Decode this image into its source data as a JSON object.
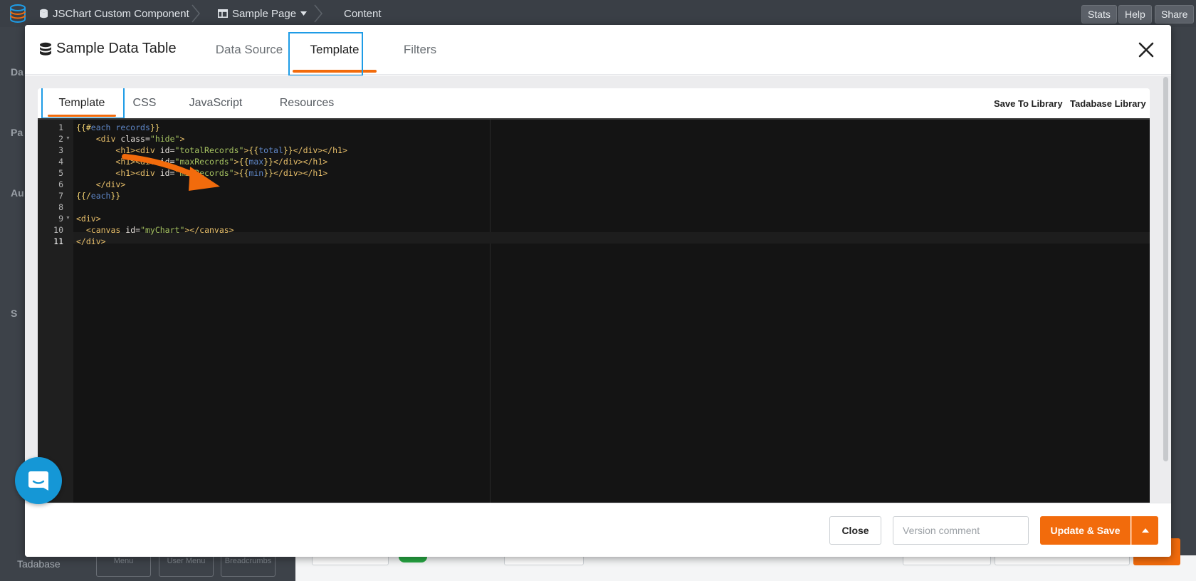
{
  "topbar": {
    "app_title": "JSChart Custom Component",
    "page": "Sample Page",
    "section": "Content",
    "buttons": {
      "stats": "Stats",
      "help": "Help",
      "share": "Share"
    }
  },
  "background": {
    "sidebar_letters": [
      "Da",
      "Pa",
      "Au",
      "S"
    ],
    "bottom_label": "Tadabase",
    "bottom_boxes": [
      "Menu",
      "User Menu",
      "Breadcrumbs"
    ]
  },
  "modal": {
    "title": "Sample Data Table",
    "tabs": [
      {
        "label": "Data Source",
        "active": false
      },
      {
        "label": "Template",
        "active": true
      },
      {
        "label": "Filters",
        "active": false
      }
    ],
    "subtabs": [
      {
        "label": "Template",
        "active": true
      },
      {
        "label": "CSS",
        "active": false
      },
      {
        "label": "JavaScript",
        "active": false
      },
      {
        "label": "Resources",
        "active": false
      }
    ],
    "library_links": {
      "save": "Save To Library",
      "library": "Tadabase Library"
    },
    "editor": {
      "current_line": 11,
      "line_numbers": [
        "1",
        "2",
        "3",
        "4",
        "5",
        "6",
        "7",
        "8",
        "9",
        "10",
        "11"
      ],
      "folds": [
        2,
        9
      ]
    },
    "footer": {
      "close_label": "Close",
      "version_placeholder": "Version comment",
      "save_label": "Update & Save"
    }
  },
  "colors": {
    "accent": "#f26b0c",
    "highlight": "#1e9ce6",
    "chat": "#1597d6",
    "editor_bg": "#141414"
  }
}
